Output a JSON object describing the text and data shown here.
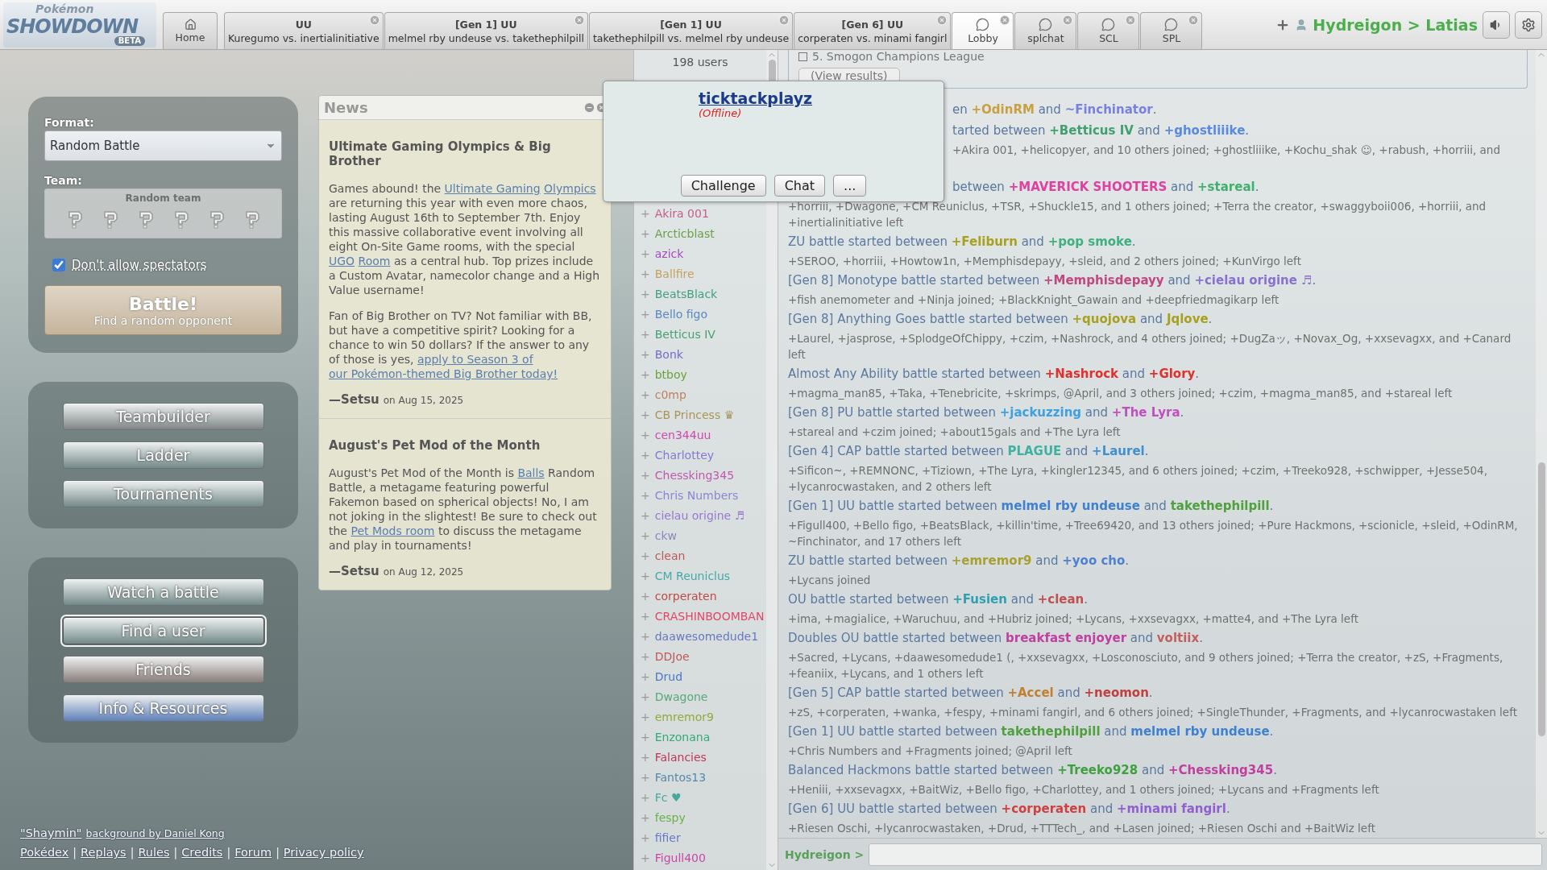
{
  "logo": {
    "top": "Pokémon",
    "main": "SHOWDOWN",
    "badge": "BETA"
  },
  "tabs": [
    {
      "kind": "home",
      "title": "Home",
      "selected": false
    },
    {
      "kind": "battle",
      "title": "UU",
      "subtitle": "Kuregumo vs. inertialinitiative",
      "selected": false
    },
    {
      "kind": "battle",
      "title": "[Gen 1] UU",
      "subtitle": "melmel rby undeuse vs. takethephilpill",
      "selected": false
    },
    {
      "kind": "battle",
      "title": "[Gen 1] UU",
      "subtitle": "takethephilpill vs. melmel rby undeuse",
      "selected": false
    },
    {
      "kind": "battle",
      "title": "[Gen 6] UU",
      "subtitle": "corperaten vs. minami fangirl",
      "selected": false
    },
    {
      "kind": "room",
      "title": "Lobby",
      "selected": true
    },
    {
      "kind": "room",
      "title": "splchat",
      "selected": false
    },
    {
      "kind": "room",
      "title": "SCL",
      "selected": false
    },
    {
      "kind": "room",
      "title": "SPL",
      "selected": false
    }
  ],
  "user_bar": {
    "name": "Hydreigon > Latias"
  },
  "format": {
    "label": "Format:",
    "value": "Random Battle"
  },
  "team": {
    "label": "Team:",
    "value": "Random team"
  },
  "spectators": {
    "label": "Don't allow spectators",
    "checked": true
  },
  "battle_button": {
    "title": "Battle!",
    "subtitle": "Find a random opponent"
  },
  "menu_groups": [
    [
      {
        "label": "Teambuilder",
        "color": "#7f8585",
        "focused": false
      },
      {
        "label": "Ladder",
        "color": "#728a88",
        "focused": false
      },
      {
        "label": "Tournaments",
        "color": "#728a88",
        "focused": false
      }
    ],
    [
      {
        "label": "Watch a battle",
        "color": "#728a88",
        "focused": false
      },
      {
        "label": "Find a user",
        "color": "#728a88",
        "focused": true
      },
      {
        "label": "Friends",
        "color": "#887d7a",
        "focused": false
      },
      {
        "label": "Info & Resources",
        "color": "#5f80b8",
        "focused": false
      }
    ]
  ],
  "footer": {
    "credit_link": "\"Shaymin\"",
    "credit_rest": "background by Daniel Kong",
    "separator": "|",
    "links": [
      "Pokédex",
      "Replays",
      "Rules",
      "Credits",
      "Forum",
      "Privacy policy"
    ]
  },
  "news": {
    "title": "News",
    "posts": [
      {
        "title": "Ultimate Gaming Olympics & Big Brother",
        "paragraphs": [
          [
            {
              "kind": "text",
              "text": "Games abound! the "
            },
            {
              "kind": "link",
              "text": "Ultimate Gaming"
            },
            {
              "kind": "link",
              "text": "Olympics"
            },
            {
              "kind": "text",
              "text": " are returning this year with even more chaos, lasting August 16th to September 7th. Enjoy this massive collaborative event involving all eight On-Site Game rooms, with the special "
            },
            {
              "kind": "link",
              "text": "UGO"
            },
            {
              "kind": "link",
              "text": "Room"
            },
            {
              "kind": "text",
              "text": " as a central hub. Top prizes include a Custom Avatar, namecolor change and a High Value username!"
            }
          ],
          [
            {
              "kind": "text",
              "text": "Fan of Big Brother on TV? Not familiar with BB, but have a competitive spirit? Looking for a chance to win 50 dollars? If the answer to any of those is yes, "
            },
            {
              "kind": "link",
              "text": "apply to Season 3 of"
            },
            {
              "kind": "link",
              "text": "our Pokémon-themed Big Brother today!"
            }
          ]
        ],
        "author": "—Setsu",
        "date": "on Aug 15, 2025"
      },
      {
        "title": "August's Pet Mod of the Month",
        "paragraphs": [
          [
            {
              "kind": "text",
              "text": "August's Pet Mod of the Month is "
            },
            {
              "kind": "link",
              "text": "Balls"
            },
            {
              "kind": "text",
              "text": " Random Battle, a metagame featuring powerful Fakemon based on spherical objects! No, I am not joking in the slightest! Be sure to check out the "
            },
            {
              "kind": "link",
              "text": "Pet Mods room"
            },
            {
              "kind": "text",
              "text": " to discuss the metagame and play in tournaments!"
            }
          ]
        ],
        "author": "—Setsu",
        "date": "on Aug 12, 2025"
      }
    ]
  },
  "popup": {
    "name": "ticktackplayz",
    "status": "(Offline)",
    "buttons": [
      "Challenge",
      "Chat",
      "..."
    ]
  },
  "userlist": {
    "count": "198 users",
    "users": [
      {
        "rank": "+",
        "name": "Akira 001",
        "color": "#c4608a"
      },
      {
        "rank": "+",
        "name": "Arcticblast",
        "color": "#6aa048"
      },
      {
        "rank": "+",
        "name": "azick",
        "color": "#a848c0"
      },
      {
        "rank": "+",
        "name": "Ballfire",
        "color": "#c8a060"
      },
      {
        "rank": "+",
        "name": "BeatsBlack",
        "color": "#44a07c"
      },
      {
        "rank": "+",
        "name": "Bello figo",
        "color": "#5a88c0"
      },
      {
        "rank": "+",
        "name": "Betticus IV",
        "color": "#48a070"
      },
      {
        "rank": "+",
        "name": "Bonk",
        "color": "#7868d0"
      },
      {
        "rank": "+",
        "name": "btboy",
        "color": "#6aa038"
      },
      {
        "rank": "+",
        "name": "c0mp",
        "color": "#c08060"
      },
      {
        "rank": "+",
        "name": "CB Princess ♛",
        "color": "#a89458"
      },
      {
        "rank": "+",
        "name": "cen344uu",
        "color": "#d048b0"
      },
      {
        "rank": "+",
        "name": "Charlottey",
        "color": "#8878d0"
      },
      {
        "rank": "+",
        "name": "Chessking345",
        "color": "#c058b0"
      },
      {
        "rank": "+",
        "name": "Chris Numbers",
        "color": "#8888d0"
      },
      {
        "rank": "+",
        "name": "cielau origine ♬",
        "color": "#9878d0"
      },
      {
        "rank": "+",
        "name": "ckw",
        "color": "#8888c0"
      },
      {
        "rank": "+",
        "name": "clean",
        "color": "#c05858"
      },
      {
        "rank": "+",
        "name": "CM Reuniclus",
        "color": "#48a8a8"
      },
      {
        "rank": "+",
        "name": "corperaten",
        "color": "#c04848"
      },
      {
        "rank": "+",
        "name": "CRASHINBOOMBAN",
        "color": "#e04868"
      },
      {
        "rank": "+",
        "name": "daawesomedude1",
        "color": "#6878c0"
      },
      {
        "rank": "+",
        "name": "DDJoe",
        "color": "#c05858"
      },
      {
        "rank": "+",
        "name": "Drud",
        "color": "#4878c8"
      },
      {
        "rank": "+",
        "name": "Dwagone",
        "color": "#58a878"
      },
      {
        "rank": "+",
        "name": "emremor9",
        "color": "#98a838"
      },
      {
        "rank": "+",
        "name": "Enzonana",
        "color": "#38a878"
      },
      {
        "rank": "+",
        "name": "Falancies",
        "color": "#c03858"
      },
      {
        "rank": "+",
        "name": "Fantos13",
        "color": "#5888a8"
      },
      {
        "rank": "+",
        "name": "Fc ♥",
        "color": "#48a8a0"
      },
      {
        "rank": "+",
        "name": "fespy",
        "color": "#68b048"
      },
      {
        "rank": "+",
        "name": "fifier",
        "color": "#6878c8"
      },
      {
        "rank": "+",
        "name": "Figull400",
        "color": "#c848a8"
      }
    ]
  },
  "chat": {
    "poll": {
      "option": "5. Smogon Champions League",
      "button": "(View results)"
    },
    "beside_popup": [
      {
        "kind": "battle",
        "parts": [
          {
            "text": "en "
          },
          {
            "text": "+OdinRM",
            "color": "#c8a040"
          },
          {
            "text": " and "
          },
          {
            "text": "~Finchinator",
            "color": "#7a80e0"
          },
          {
            "text": "."
          }
        ]
      },
      {
        "kind": "battle",
        "parts": [
          {
            "text": "tarted between "
          },
          {
            "text": "+Betticus IV",
            "color": "#40a070"
          },
          {
            "text": " and "
          },
          {
            "text": "+ghostliiike",
            "color": "#5a8ae0"
          },
          {
            "text": "."
          }
        ]
      },
      {
        "kind": "joins",
        "parts": [
          {
            "text": "+Akira 001, +helicopyer, and 10 others joined; +ghostliiike, +Kochu_shak ☺, +rabush, +horriii, and"
          }
        ]
      },
      {
        "kind": "battle",
        "parts": [
          {
            "text": " between "
          },
          {
            "text": "+MAVERICK SHOOTERS",
            "color": "#e040a0"
          },
          {
            "text": " and "
          },
          {
            "text": "+stareal",
            "color": "#40b070"
          },
          {
            "text": "."
          }
        ]
      }
    ],
    "messages": [
      {
        "kind": "joins",
        "parts": [
          {
            "text": "+horriii, +Dwagone, +CM Reuniclus, +TSR, +Shuckle15, and 1 others joined; +Terra the creator, +swaggyboii006, +horriii, and +inertialinitiative left"
          }
        ]
      },
      {
        "kind": "battle",
        "parts": [
          {
            "text": "ZU battle started between "
          },
          {
            "text": "+Feliburn",
            "color": "#a8a020"
          },
          {
            "text": " and "
          },
          {
            "text": "+pop smoke",
            "color": "#40b080"
          },
          {
            "text": "."
          }
        ]
      },
      {
        "kind": "joins",
        "parts": [
          {
            "text": "+SEROO, +horriii, +Howtow1n, +Memphisdepayy, +sleid, and 2 others joined; +KunVirgo left"
          }
        ]
      },
      {
        "kind": "battle",
        "parts": [
          {
            "text": "[Gen 8] Monotype battle started between "
          },
          {
            "text": "+Memphisdepayy",
            "color": "#c04880"
          },
          {
            "text": " and "
          },
          {
            "text": "+cielau origine ♬",
            "color": "#8a70d0"
          },
          {
            "text": "."
          }
        ]
      },
      {
        "kind": "joins",
        "parts": [
          {
            "text": "+fish anemometer and +Ninja joined; +BlackKnight_Gawain and +deepfriedmagikarp left"
          }
        ]
      },
      {
        "kind": "battle",
        "parts": [
          {
            "text": "[Gen 8] Anything Goes battle started between "
          },
          {
            "text": "+quojova",
            "color": "#a8a020"
          },
          {
            "text": " and "
          },
          {
            "text": "Jqlove",
            "color": "#a8a020"
          },
          {
            "text": "."
          }
        ]
      },
      {
        "kind": "joins",
        "parts": [
          {
            "text": "+Laurel, +jasprose, +SplodgeOfChippy, +czim, +Nashrock, and 4 others joined; +DugZaッ, +Novax_Og, +xxsevagxx, and +Canard left"
          }
        ]
      },
      {
        "kind": "battle",
        "parts": [
          {
            "text": "Almost Any Ability battle started between "
          },
          {
            "text": "+Nashrock",
            "color": "#e03030"
          },
          {
            "text": " and "
          },
          {
            "text": "+Glory",
            "color": "#e03030"
          },
          {
            "text": "."
          }
        ]
      },
      {
        "kind": "joins",
        "parts": [
          {
            "text": "+magma_man85, +Taka, +Tenebricite, +skrimps, @April, and 3 others joined; +czim, +magma_man85, and +stareal left"
          }
        ]
      },
      {
        "kind": "battle",
        "parts": [
          {
            "text": "[Gen 8] PU battle started between "
          },
          {
            "text": "+jackuzzing",
            "color": "#40a0e0"
          },
          {
            "text": " and "
          },
          {
            "text": "+The Lyra",
            "color": "#c050c0"
          },
          {
            "text": "."
          }
        ]
      },
      {
        "kind": "joins",
        "parts": [
          {
            "text": "+stareal and +czim joined; +about15gals and +The Lyra left"
          }
        ]
      },
      {
        "kind": "battle",
        "parts": [
          {
            "text": "[Gen 4] CAP battle started between "
          },
          {
            "text": "PLAGUE",
            "color": "#40b0a0"
          },
          {
            "text": " and "
          },
          {
            "text": "+Laurel",
            "color": "#4090d0"
          },
          {
            "text": "."
          }
        ]
      },
      {
        "kind": "joins",
        "parts": [
          {
            "text": "+Sificon~, +REMNONC, +Tiziown, +The Lyra, +kingler12345, and 6 others joined; +czim, +Treeko928, +schwipper, +Jesse504, +lycanrocwastaken, and 2 others left"
          }
        ]
      },
      {
        "kind": "battle",
        "parts": [
          {
            "text": "[Gen 1] UU battle started between "
          },
          {
            "text": "melmel rby undeuse",
            "color": "#4080d0"
          },
          {
            "text": " and "
          },
          {
            "text": "takethephilpill",
            "color": "#50a040"
          },
          {
            "text": "."
          }
        ]
      },
      {
        "kind": "joins",
        "parts": [
          {
            "text": "+Figull400, +Bello figo, +BeatsBlack, +killin'time, +Tree69420, and 13 others joined; +Pure Hackmons, +scionicle, +sleid, +OdinRM, ~Finchinator, and 17 others left"
          }
        ]
      },
      {
        "kind": "battle",
        "parts": [
          {
            "text": "ZU battle started between "
          },
          {
            "text": "+emremor9",
            "color": "#a8a030"
          },
          {
            "text": " and "
          },
          {
            "text": "+yoo cho",
            "color": "#5080d0"
          },
          {
            "text": "."
          }
        ]
      },
      {
        "kind": "joins",
        "parts": [
          {
            "text": "+Lycans joined"
          }
        ]
      },
      {
        "kind": "battle",
        "parts": [
          {
            "text": "OU battle started between "
          },
          {
            "text": "+Fusien",
            "color": "#30a0b0"
          },
          {
            "text": " and "
          },
          {
            "text": "+clean",
            "color": "#c05050"
          },
          {
            "text": "."
          }
        ]
      },
      {
        "kind": "joins",
        "parts": [
          {
            "text": "+ima, +magialice, +Waruchuu, and +Hubriz joined; +Lycans, +xxsevagxx, +matte4, and +The Lyra left"
          }
        ]
      },
      {
        "kind": "battle",
        "parts": [
          {
            "text": "Doubles OU battle started between "
          },
          {
            "text": "breakfast enjoyer",
            "color": "#c040a0"
          },
          {
            "text": " and "
          },
          {
            "text": "voltiix",
            "color": "#c06060"
          },
          {
            "text": "."
          }
        ]
      },
      {
        "kind": "joins",
        "parts": [
          {
            "text": "+Sacred, +Lycans, +daawesomedude1 (, +xxsevagxx, +Losconosciuto, and 9 others joined; +Terra the creator, +zS, +Fragments, +feaniix, +Lycans, and 1 others left"
          }
        ]
      },
      {
        "kind": "battle",
        "parts": [
          {
            "text": "[Gen 5] CAP battle started between "
          },
          {
            "text": "+Accel",
            "color": "#c08030"
          },
          {
            "text": " and "
          },
          {
            "text": "+neomon",
            "color": "#c04040"
          },
          {
            "text": "."
          }
        ]
      },
      {
        "kind": "joins",
        "parts": [
          {
            "text": "+zS, +corperaten, +wanka, +fespy, +minami fangirl, and 6 others joined; +SingleThunder, +Fragments, and +lycanrocwastaken left"
          }
        ]
      },
      {
        "kind": "battle",
        "parts": [
          {
            "text": "[Gen 1] UU battle started between "
          },
          {
            "text": "takethephilpill",
            "color": "#50a040"
          },
          {
            "text": " and "
          },
          {
            "text": "melmel rby undeuse",
            "color": "#4080d0"
          },
          {
            "text": "."
          }
        ]
      },
      {
        "kind": "joins",
        "parts": [
          {
            "text": "+Chris Numbers and +Fragments joined; @April left"
          }
        ]
      },
      {
        "kind": "battle",
        "parts": [
          {
            "text": "Balanced Hackmons battle started between "
          },
          {
            "text": "+Treeko928",
            "color": "#40a040"
          },
          {
            "text": " and "
          },
          {
            "text": "+Chessking345",
            "color": "#c040a0"
          },
          {
            "text": "."
          }
        ]
      },
      {
        "kind": "joins",
        "parts": [
          {
            "text": "+Heniii, +xxsevagxx, +BaitWiz, +Bello figo, +Charlottey, and 1 others joined; +Lycans and +Fragments left"
          }
        ]
      },
      {
        "kind": "battle",
        "parts": [
          {
            "text": "[Gen 6] UU battle started between "
          },
          {
            "text": "+corperaten",
            "color": "#d04040"
          },
          {
            "text": " and "
          },
          {
            "text": "+minami fangirl",
            "color": "#9060d0"
          },
          {
            "text": "."
          }
        ]
      },
      {
        "kind": "joins",
        "parts": [
          {
            "text": "+Riesen Oschi, +lycanrocwastaken, +Drud, +TTTech_, and +Lasen joined; +Riesen Oschi and +BaitWiz left"
          }
        ]
      }
    ],
    "prompt": "Hydreigon >"
  }
}
